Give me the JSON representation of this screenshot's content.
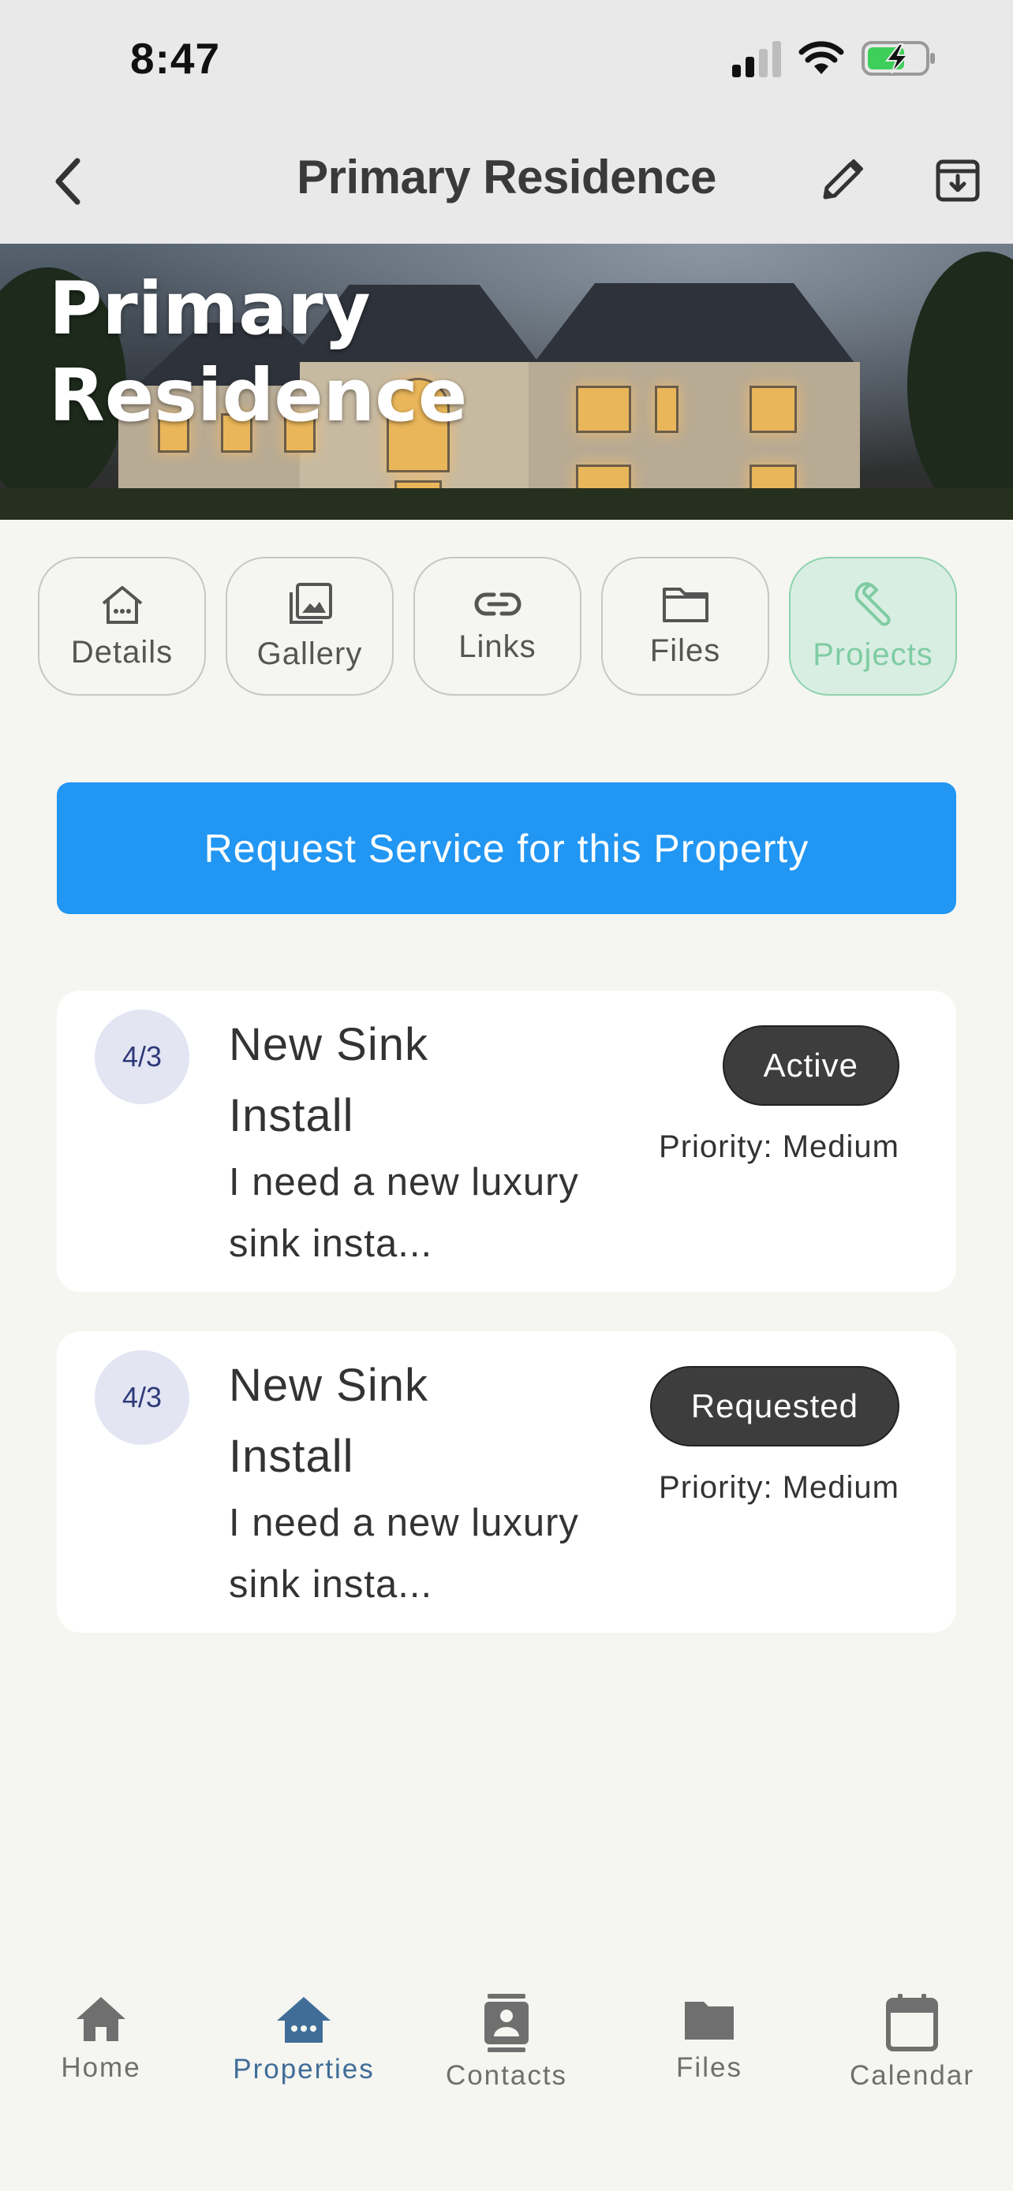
{
  "status_bar": {
    "time": "8:47",
    "icons": [
      "cellular-signal-icon",
      "wifi-icon",
      "battery-charging-icon"
    ],
    "battery_color": "#3ecf5a"
  },
  "header": {
    "title": "Primary Residence",
    "back_icon": "chevron-left-icon",
    "edit_icon": "pencil-icon",
    "archive_icon": "archive-icon"
  },
  "hero": {
    "title": "Primary Residence",
    "image": "luxury-mansion-at-dusk"
  },
  "tabs": [
    {
      "label": "Details",
      "icon": "house-icon",
      "active": false
    },
    {
      "label": "Gallery",
      "icon": "gallery-icon",
      "active": false
    },
    {
      "label": "Links",
      "icon": "link-icon",
      "active": false
    },
    {
      "label": "Files",
      "icon": "folder-icon",
      "active": false
    },
    {
      "label": "Projects",
      "icon": "wrench-icon",
      "active": true
    }
  ],
  "request_button": {
    "label": "Request Service for this Property",
    "color": "#2196f3"
  },
  "projects": [
    {
      "date": "4/3",
      "title": "New Sink Install",
      "description": "I need a new luxury sink insta...",
      "status": "Active",
      "priority": "Priority: Medium"
    },
    {
      "date": "4/3",
      "title": "New Sink Install",
      "description": "I need a new luxury sink insta...",
      "status": "Requested",
      "priority": "Priority: Medium"
    }
  ],
  "bottom_nav": [
    {
      "label": "Home",
      "icon": "home-icon",
      "active": false
    },
    {
      "label": "Properties",
      "icon": "properties-icon",
      "active": true
    },
    {
      "label": "Contacts",
      "icon": "contacts-icon",
      "active": false
    },
    {
      "label": "Files",
      "icon": "folder-icon",
      "active": false
    },
    {
      "label": "Calendar",
      "icon": "calendar-icon",
      "active": false
    }
  ],
  "colors": {
    "accent": "#2196f3",
    "active_tab": "#7fcca3",
    "active_nav": "#3f6d97",
    "badge": "#3d3d3d"
  }
}
